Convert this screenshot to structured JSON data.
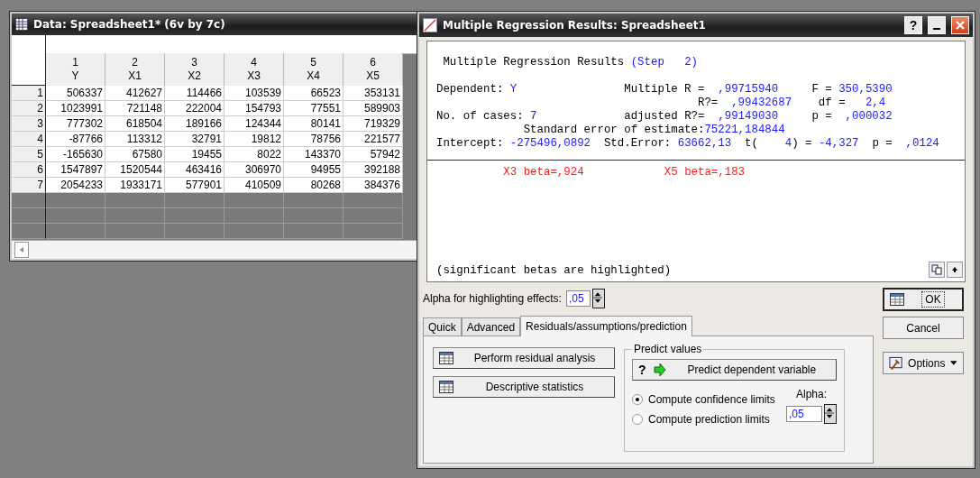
{
  "spreadsheet": {
    "title": "Data: Spreadsheet1* (6v by 7c)",
    "columns": [
      {
        "number": "1",
        "name": "Y"
      },
      {
        "number": "2",
        "name": "X1"
      },
      {
        "number": "3",
        "name": "X2"
      },
      {
        "number": "4",
        "name": "X3"
      },
      {
        "number": "5",
        "name": "X4"
      },
      {
        "number": "6",
        "name": "X5"
      }
    ],
    "rows": [
      {
        "label": "1",
        "cells": [
          "506337",
          "412627",
          "114466",
          "103539",
          "66523",
          "353131"
        ]
      },
      {
        "label": "2",
        "cells": [
          "1023991",
          "721148",
          "222004",
          "154793",
          "77551",
          "589903"
        ]
      },
      {
        "label": "3",
        "cells": [
          "777302",
          "618504",
          "189166",
          "124344",
          "80141",
          "719329"
        ]
      },
      {
        "label": "4",
        "cells": [
          "-87766",
          "113312",
          "32791",
          "19812",
          "78756",
          "221577"
        ]
      },
      {
        "label": "5",
        "cells": [
          "-165630",
          "67580",
          "19455",
          "8022",
          "143370",
          "57942"
        ]
      },
      {
        "label": "6",
        "cells": [
          "1547897",
          "1520544",
          "463416",
          "306970",
          "94955",
          "392188"
        ]
      },
      {
        "label": "7",
        "cells": [
          "2054233",
          "1933171",
          "577901",
          "410509",
          "80268",
          "384376"
        ]
      }
    ]
  },
  "results": {
    "title": "Multiple Regression Results: Spreadsheet1",
    "help_label": "?",
    "output": {
      "header": [
        {
          "text": " Multiple Regression Results ",
          "kind": "label"
        },
        {
          "text": "(Step   2)",
          "kind": "value"
        }
      ],
      "stats": [
        [
          {
            "text": "Dependent: ",
            "kind": "label"
          },
          {
            "text": "Y",
            "kind": "value"
          },
          {
            "text": "                Multiple R =  ",
            "kind": "label"
          },
          {
            "text": ",99715940",
            "kind": "value"
          },
          {
            "text": "     F = ",
            "kind": "label"
          },
          {
            "text": "350,5390",
            "kind": "value"
          }
        ],
        [
          {
            "text": "                                       R?=  ",
            "kind": "label"
          },
          {
            "text": ",99432687",
            "kind": "value"
          },
          {
            "text": "    df =   ",
            "kind": "label"
          },
          {
            "text": "2,4",
            "kind": "value"
          }
        ],
        [
          {
            "text": "No. of cases: ",
            "kind": "label"
          },
          {
            "text": "7",
            "kind": "value"
          },
          {
            "text": "             adjusted R?=  ",
            "kind": "label"
          },
          {
            "text": ",99149030",
            "kind": "value"
          },
          {
            "text": "     p =  ",
            "kind": "label"
          },
          {
            "text": ",000032",
            "kind": "value"
          }
        ],
        [
          {
            "text": "             Standard error of estimate:",
            "kind": "label"
          },
          {
            "text": "75221,184844",
            "kind": "value"
          }
        ],
        [
          {
            "text": "Intercept: ",
            "kind": "label"
          },
          {
            "text": "-275496,0892",
            "kind": "value"
          },
          {
            "text": "  Std.Error: ",
            "kind": "label"
          },
          {
            "text": "63662,13",
            "kind": "value"
          },
          {
            "text": "  t(    ",
            "kind": "label"
          },
          {
            "text": "4",
            "kind": "value"
          },
          {
            "text": ") = ",
            "kind": "label"
          },
          {
            "text": "-4,327",
            "kind": "value"
          },
          {
            "text": "  p =  ",
            "kind": "label"
          },
          {
            "text": ",0124",
            "kind": "value"
          }
        ]
      ],
      "betas": [
        {
          "text": "          X3 beta=,924",
          "kind": "highlight"
        },
        {
          "text": "            X5 beta=,183",
          "kind": "highlight"
        }
      ],
      "note": "(significant betas are highlighted)"
    },
    "alpha_label": "Alpha for highlighting effects:",
    "alpha_value": ",05",
    "tabs": [
      {
        "label": "Quick",
        "selected": false
      },
      {
        "label": "Advanced",
        "selected": false
      },
      {
        "label": "Residuals/assumptions/prediction",
        "selected": true
      }
    ],
    "panel": {
      "buttons": [
        "Perform residual analysis",
        "Descriptive statistics"
      ],
      "group": {
        "title": "Predict values",
        "button_mark": "?",
        "button": "Predict dependent variable",
        "options": [
          {
            "label": "Compute confidence limits",
            "selected": true
          },
          {
            "label": "Compute prediction limits",
            "selected": false
          }
        ],
        "alpha_label": "Alpha:",
        "alpha_value": ",05"
      }
    },
    "side_buttons": [
      {
        "label": "OK",
        "kind": "ok"
      },
      {
        "label": "Cancel",
        "kind": "plain"
      },
      {
        "label": "Options",
        "kind": "menu"
      }
    ]
  }
}
